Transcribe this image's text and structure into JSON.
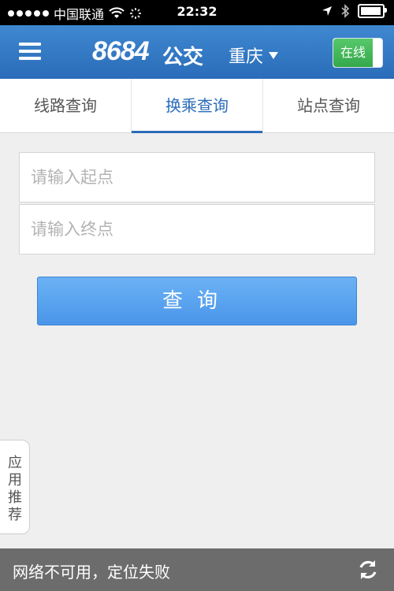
{
  "status_bar": {
    "carrier": "中国联通",
    "time": "22:32",
    "battery_level": 0.95
  },
  "header": {
    "logo": "8684",
    "logo_suffix": "公交",
    "city": "重庆",
    "city_dropdown_icon": "triangle-down-icon",
    "online_label": "在线",
    "menu_icon": "hamburger-menu-icon"
  },
  "tabs": [
    {
      "label": "线路查询",
      "active": false
    },
    {
      "label": "换乘查询",
      "active": true
    },
    {
      "label": "站点查询",
      "active": false
    }
  ],
  "form": {
    "start_placeholder": "请输入起点",
    "end_placeholder": "请输入终点",
    "query_button": "查询"
  },
  "side_tab": {
    "label": "应用推荐"
  },
  "bottom_bar": {
    "message": "网络不可用，定位失败",
    "refresh_icon": "refresh-icon"
  },
  "colors": {
    "header_blue": "#2a6cb9",
    "button_blue": "#4a95e9",
    "online_green": "#35a84d",
    "bottom_gray": "#6c6c6c"
  }
}
